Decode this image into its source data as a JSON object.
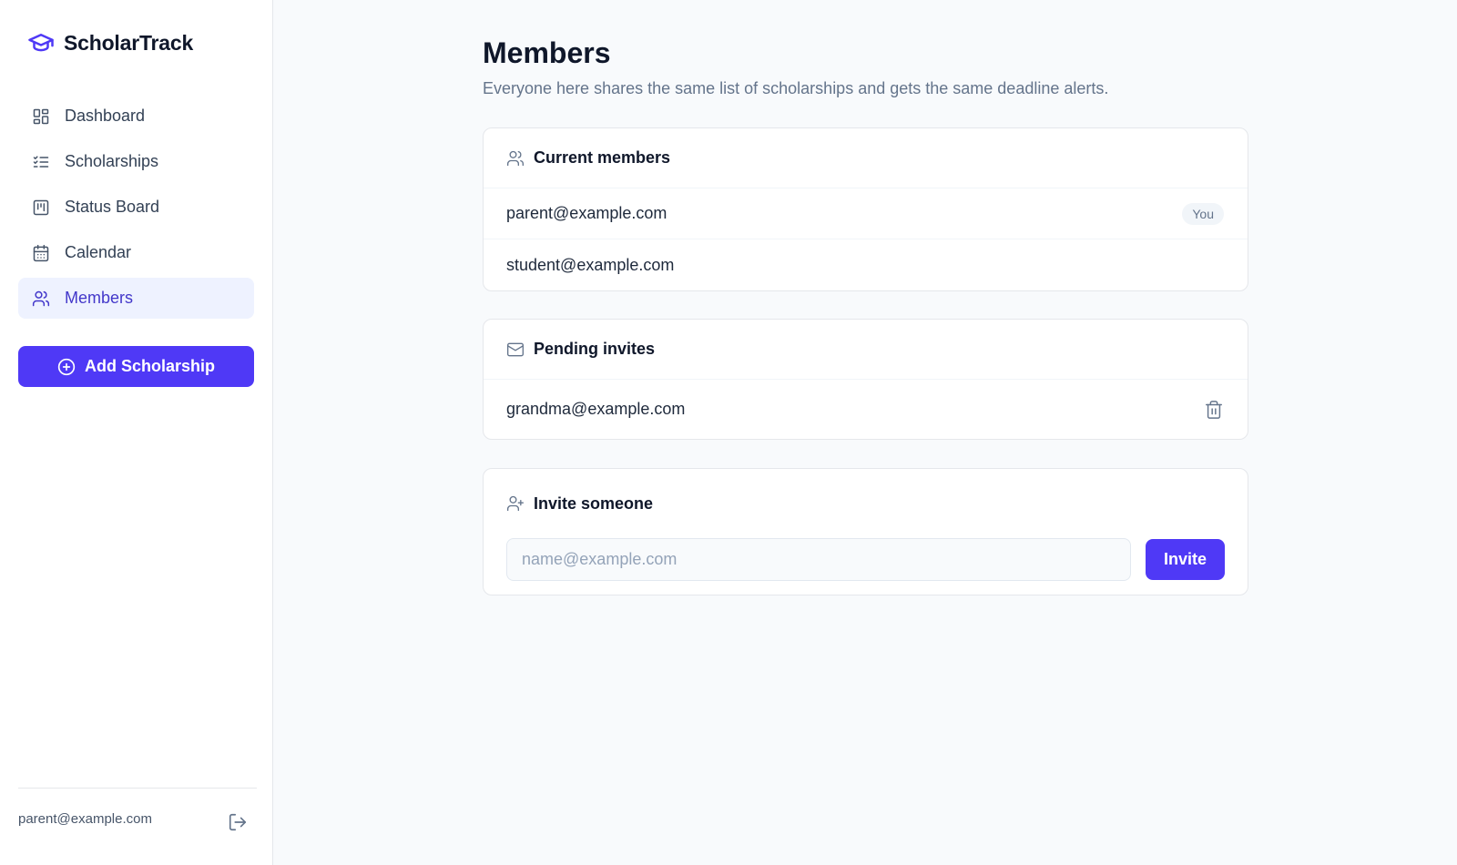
{
  "brand": {
    "name": "ScholarTrack",
    "icon": "graduation-cap-icon",
    "accent": "#4f39f6"
  },
  "sidebar": {
    "items": [
      {
        "label": "Dashboard",
        "icon": "dashboard-icon",
        "active": false
      },
      {
        "label": "Scholarships",
        "icon": "checklist-icon",
        "active": false
      },
      {
        "label": "Status Board",
        "icon": "kanban-icon",
        "active": false
      },
      {
        "label": "Calendar",
        "icon": "calendar-icon",
        "active": false
      },
      {
        "label": "Members",
        "icon": "users-icon",
        "active": true
      }
    ],
    "add_button": "Add Scholarship",
    "user_email": "parent@example.com",
    "logout_icon": "logout-icon"
  },
  "main": {
    "title": "Members",
    "subtitle": "Everyone here shares the same list of scholarships and gets the same deadline alerts.",
    "current_members": {
      "title": "Current members",
      "rows": [
        {
          "email": "parent@example.com",
          "badge": "You"
        },
        {
          "email": "student@example.com"
        }
      ]
    },
    "pending_invites": {
      "title": "Pending invites",
      "rows": [
        {
          "email": "grandma@example.com"
        }
      ]
    },
    "invite": {
      "title": "Invite someone",
      "placeholder": "name@example.com",
      "value": "",
      "button": "Invite"
    }
  }
}
